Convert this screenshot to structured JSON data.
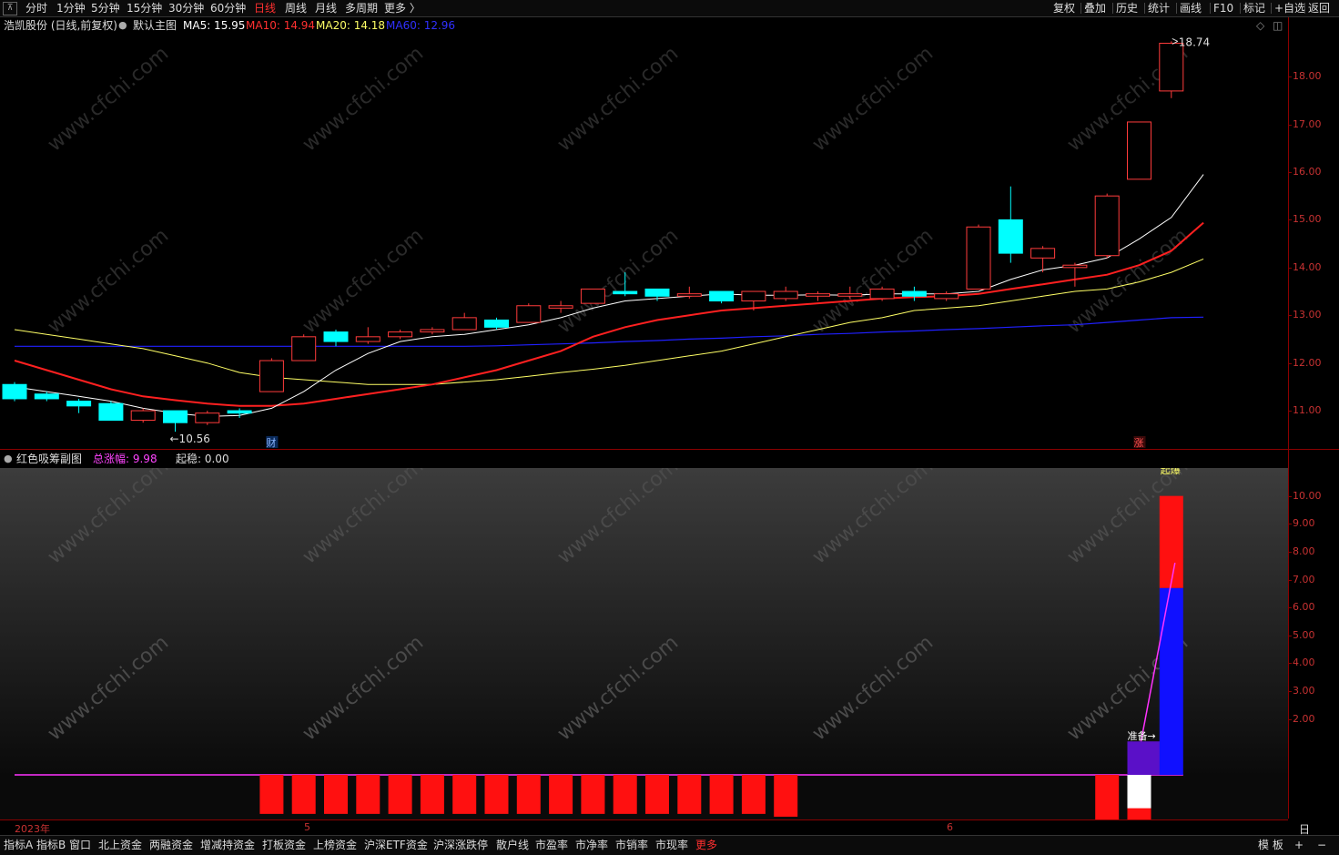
{
  "toolbar": {
    "timeframes": [
      "分时",
      "1分钟",
      "5分钟",
      "15分钟",
      "30分钟",
      "60分钟",
      "日线",
      "周线",
      "月线",
      "多周期",
      "更多 〉"
    ],
    "active_timeframe": "日线",
    "right_items": [
      "复权",
      "叠加",
      "历史",
      "统计",
      "画线",
      "F10",
      "标记",
      "+自选",
      "返回"
    ]
  },
  "header": {
    "stock": "浩凯股份 (日线,前复权)",
    "template": "默认主图",
    "ma5": "MA5: 15.95",
    "ma10": "MA10: 14.94",
    "ma20": "MA20: 14.18",
    "ma60": "MA60: 12.96"
  },
  "main_axis": [
    "18.00",
    "17.00",
    "16.00",
    "15.00",
    "14.00",
    "13.00",
    "12.00",
    "11.00"
  ],
  "main_labels": {
    "high": "18.74",
    "low": "←10.56",
    "cai": "财",
    "zhang": "涨"
  },
  "sub_header": {
    "name": "红色吸筹副图",
    "total": "总涨幅: 9.98",
    "qiwen": "起稳: 0.00"
  },
  "sub_axis": [
    "10.00",
    "9.00",
    "8.00",
    "7.00",
    "6.00",
    "5.00",
    "4.00",
    "3.00",
    "2.00"
  ],
  "sub_labels": {
    "prepare": "准备→",
    "top": "起爆"
  },
  "xaxis": {
    "year": "2023年",
    "m5": "5",
    "m6": "6",
    "period": "日线"
  },
  "bottom_tabs": [
    "指标A",
    "指标B",
    "窗口",
    "北上资金",
    "两融资金",
    "增减持资金",
    "打板资金",
    "上榜资金",
    "沪深ETF资金",
    "沪深涨跌停",
    "散户线",
    "市盈率",
    "市净率",
    "市销率",
    "市现率",
    "更多"
  ],
  "bottom_right": [
    "模 板",
    "+",
    "−"
  ],
  "watermark": "www.cfchi.com",
  "colors": {
    "up": "#ff3b3b",
    "down": "#00ffff",
    "ma5": "#ffffff",
    "ma10": "#ff2020",
    "ma20": "#ffff66",
    "ma60": "#2020ff",
    "axis": "#8b0000"
  },
  "chart_data": {
    "type": "candlestick",
    "ylim": [
      10.2,
      18.9
    ],
    "candles": [
      {
        "o": 11.55,
        "c": 11.25,
        "h": 11.6,
        "l": 11.2
      },
      {
        "o": 11.35,
        "c": 11.25,
        "h": 11.4,
        "l": 11.2
      },
      {
        "o": 11.2,
        "c": 11.1,
        "h": 11.25,
        "l": 10.95
      },
      {
        "o": 11.15,
        "c": 10.8,
        "h": 11.2,
        "l": 10.8
      },
      {
        "o": 10.8,
        "c": 11.0,
        "h": 11.05,
        "l": 10.75
      },
      {
        "o": 11.0,
        "c": 10.75,
        "h": 11.0,
        "l": 10.56
      },
      {
        "o": 10.75,
        "c": 10.95,
        "h": 11.0,
        "l": 10.7
      },
      {
        "o": 11.0,
        "c": 10.95,
        "h": 11.05,
        "l": 10.85
      },
      {
        "o": 11.4,
        "c": 12.05,
        "h": 12.1,
        "l": 11.4
      },
      {
        "o": 12.05,
        "c": 12.55,
        "h": 12.6,
        "l": 12.05
      },
      {
        "o": 12.65,
        "c": 12.45,
        "h": 12.7,
        "l": 12.35
      },
      {
        "o": 12.45,
        "c": 12.55,
        "h": 12.75,
        "l": 12.4
      },
      {
        "o": 12.55,
        "c": 12.65,
        "h": 12.7,
        "l": 12.5
      },
      {
        "o": 12.65,
        "c": 12.7,
        "h": 12.75,
        "l": 12.6
      },
      {
        "o": 12.7,
        "c": 12.95,
        "h": 13.05,
        "l": 12.7
      },
      {
        "o": 12.9,
        "c": 12.75,
        "h": 12.95,
        "l": 12.7
      },
      {
        "o": 12.85,
        "c": 13.2,
        "h": 13.25,
        "l": 12.85
      },
      {
        "o": 13.15,
        "c": 13.2,
        "h": 13.3,
        "l": 13.05
      },
      {
        "o": 13.25,
        "c": 13.55,
        "h": 13.55,
        "l": 13.25
      },
      {
        "o": 13.5,
        "c": 13.45,
        "h": 13.9,
        "l": 13.4
      },
      {
        "o": 13.55,
        "c": 13.4,
        "h": 13.55,
        "l": 13.3
      },
      {
        "o": 13.4,
        "c": 13.45,
        "h": 13.6,
        "l": 13.35
      },
      {
        "o": 13.5,
        "c": 13.3,
        "h": 13.5,
        "l": 13.25
      },
      {
        "o": 13.3,
        "c": 13.5,
        "h": 13.5,
        "l": 13.1
      },
      {
        "o": 13.35,
        "c": 13.5,
        "h": 13.6,
        "l": 13.3
      },
      {
        "o": 13.4,
        "c": 13.45,
        "h": 13.5,
        "l": 13.3
      },
      {
        "o": 13.4,
        "c": 13.45,
        "h": 13.6,
        "l": 13.35
      },
      {
        "o": 13.35,
        "c": 13.55,
        "h": 13.6,
        "l": 13.3
      },
      {
        "o": 13.5,
        "c": 13.4,
        "h": 13.6,
        "l": 13.3
      },
      {
        "o": 13.35,
        "c": 13.45,
        "h": 13.5,
        "l": 13.3
      },
      {
        "o": 13.55,
        "c": 14.85,
        "h": 14.9,
        "l": 13.55
      },
      {
        "o": 15.0,
        "c": 14.3,
        "h": 15.7,
        "l": 14.1
      },
      {
        "o": 14.2,
        "c": 14.4,
        "h": 14.45,
        "l": 13.9
      },
      {
        "o": 14.0,
        "c": 14.05,
        "h": 14.1,
        "l": 13.6
      },
      {
        "o": 14.25,
        "c": 15.5,
        "h": 15.55,
        "l": 14.2
      },
      {
        "o": 15.85,
        "c": 17.05,
        "h": 17.05,
        "l": 15.85
      },
      {
        "o": 17.7,
        "c": 18.7,
        "h": 18.74,
        "l": 17.55
      }
    ],
    "ma5": [
      11.5,
      11.4,
      11.3,
      11.2,
      11.05,
      10.95,
      10.88,
      10.9,
      11.05,
      11.4,
      11.85,
      12.2,
      12.45,
      12.55,
      12.6,
      12.7,
      12.8,
      12.95,
      13.15,
      13.3,
      13.35,
      13.4,
      13.45,
      13.42,
      13.42,
      13.43,
      13.42,
      13.45,
      13.45,
      13.45,
      13.5,
      13.75,
      13.95,
      14.05,
      14.2,
      14.6,
      15.05,
      15.95
    ],
    "ma10": [
      12.05,
      11.85,
      11.65,
      11.45,
      11.3,
      11.22,
      11.15,
      11.1,
      11.1,
      11.15,
      11.25,
      11.35,
      11.45,
      11.55,
      11.7,
      11.85,
      12.05,
      12.25,
      12.55,
      12.75,
      12.9,
      13.0,
      13.1,
      13.15,
      13.2,
      13.25,
      13.3,
      13.35,
      13.38,
      13.4,
      13.45,
      13.55,
      13.65,
      13.75,
      13.85,
      14.05,
      14.35,
      14.94
    ],
    "ma20": [
      12.7,
      12.6,
      12.5,
      12.4,
      12.3,
      12.15,
      12.0,
      11.8,
      11.7,
      11.65,
      11.6,
      11.55,
      11.55,
      11.55,
      11.6,
      11.65,
      11.72,
      11.8,
      11.87,
      11.95,
      12.05,
      12.15,
      12.25,
      12.4,
      12.55,
      12.7,
      12.85,
      12.95,
      13.1,
      13.15,
      13.2,
      13.3,
      13.4,
      13.5,
      13.55,
      13.7,
      13.9,
      14.18
    ],
    "ma60": [
      12.35,
      12.35,
      12.35,
      12.35,
      12.35,
      12.35,
      12.35,
      12.35,
      12.35,
      12.35,
      12.35,
      12.35,
      12.35,
      12.35,
      12.35,
      12.36,
      12.38,
      12.4,
      12.42,
      12.45,
      12.47,
      12.5,
      12.52,
      12.55,
      12.57,
      12.6,
      12.62,
      12.65,
      12.67,
      12.7,
      12.72,
      12.75,
      12.78,
      12.8,
      12.85,
      12.9,
      12.95,
      12.96
    ]
  },
  "sub_chart_data": {
    "type": "bar",
    "ylim": [
      -1.6,
      11.0
    ],
    "red_bars_below": [
      0,
      0,
      0,
      0,
      0,
      0,
      0,
      0,
      1.4,
      1.4,
      1.4,
      1.4,
      1.4,
      1.4,
      1.4,
      1.4,
      1.4,
      1.4,
      1.4,
      1.4,
      1.4,
      1.4,
      1.4,
      1.4,
      1.5,
      0,
      0,
      0,
      0,
      0,
      0,
      0,
      0,
      0,
      1.7,
      1.75,
      0
    ],
    "purple_bar": {
      "index": 35,
      "top": 1.2,
      "bottom": 0
    },
    "white_bar": {
      "index": 35,
      "top": 0,
      "bottom": -1.2
    },
    "blue_bar": {
      "index": 36,
      "top": 6.7,
      "bottom": 0
    },
    "red_top_bar": {
      "index": 36,
      "top": 10.0,
      "bottom": 6.7
    },
    "baseline": 0
  }
}
